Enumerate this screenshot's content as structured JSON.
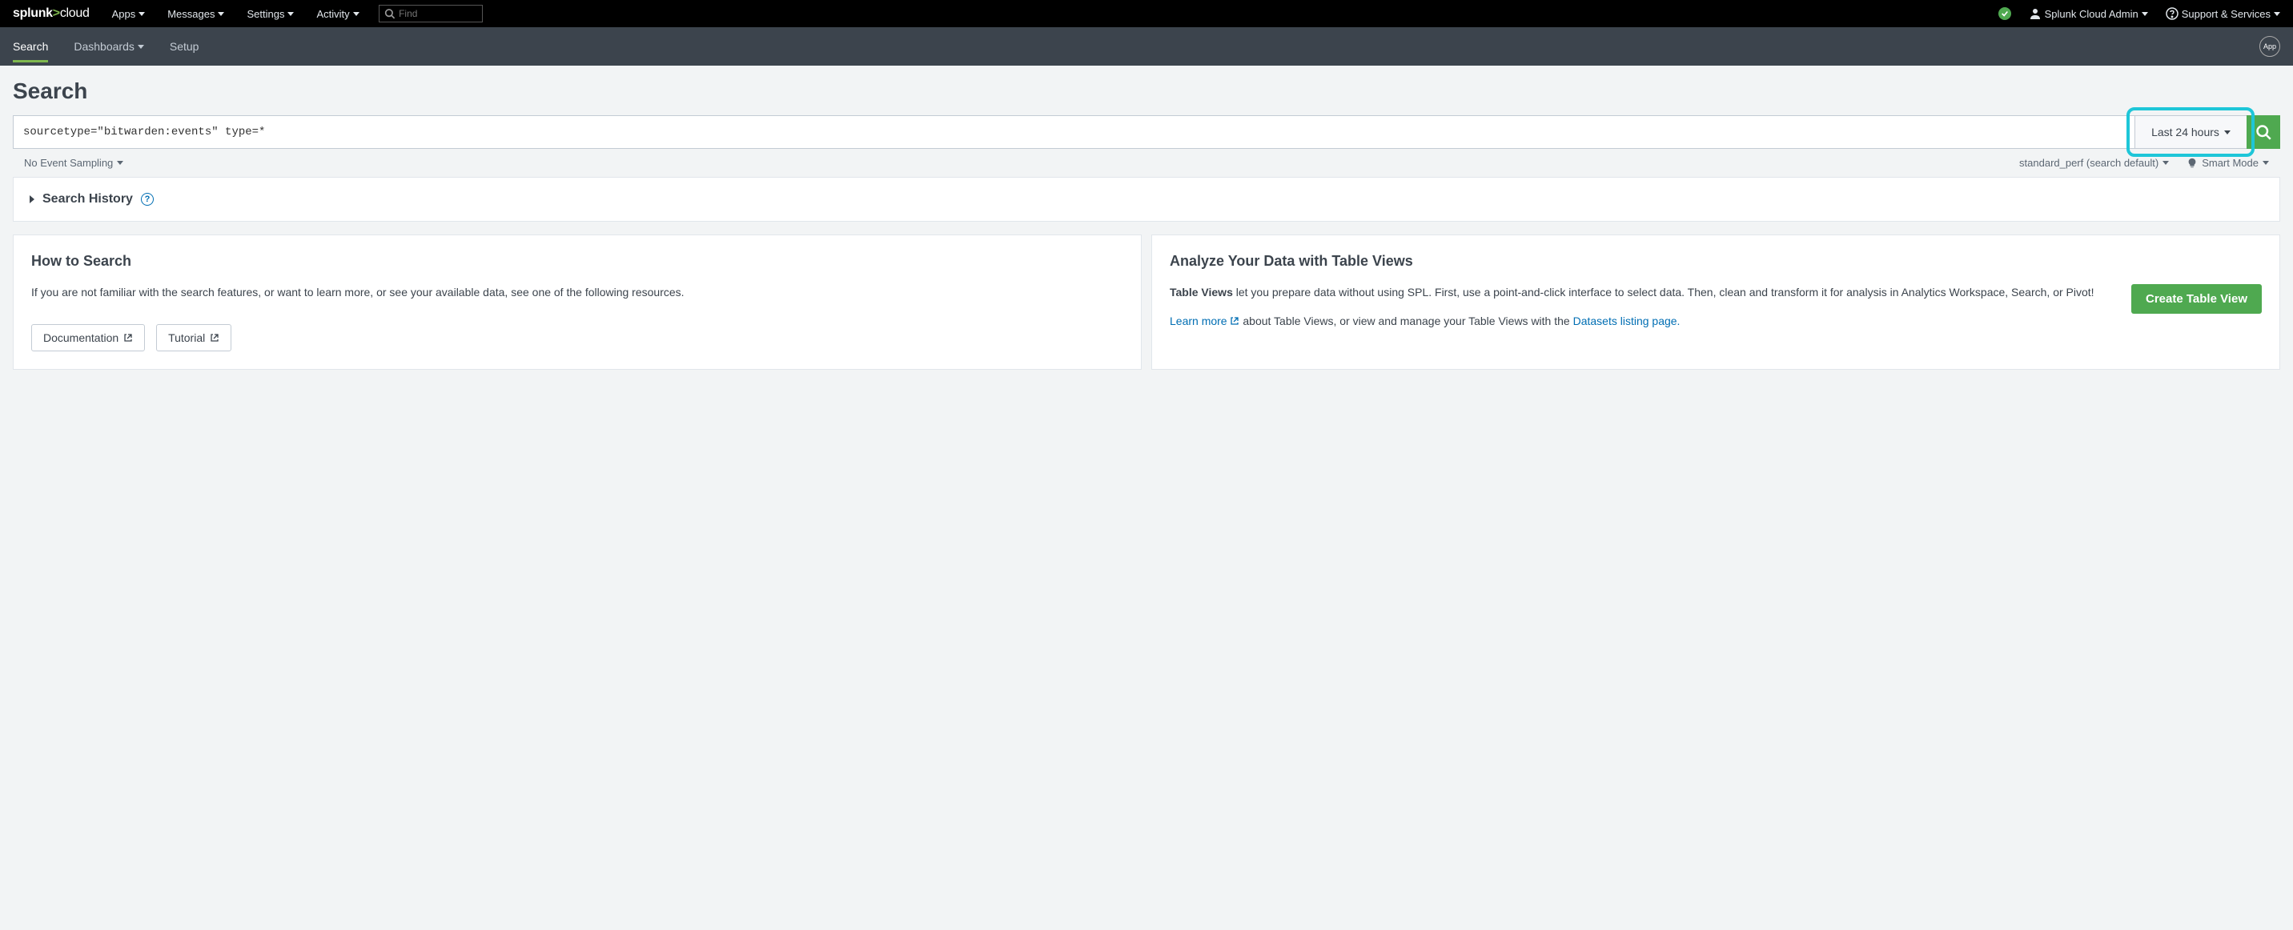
{
  "topbar": {
    "logo_prefix": "splunk",
    "logo_gt": ">",
    "logo_suffix": "cloud",
    "nav": {
      "apps": "Apps",
      "messages": "Messages",
      "settings": "Settings",
      "activity": "Activity"
    },
    "find_placeholder": "Find",
    "user_label": "Splunk Cloud Admin",
    "support_label": "Support & Services"
  },
  "subbar": {
    "search": "Search",
    "dashboards": "Dashboards",
    "setup": "Setup",
    "app_badge": "App"
  },
  "page": {
    "title": "Search"
  },
  "searchbar": {
    "query": "sourcetype=\"bitwarden:events\" type=*",
    "time_range": "Last 24 hours"
  },
  "subrow": {
    "sampling": "No Event Sampling",
    "workload": "standard_perf (search default)",
    "mode": "Smart Mode"
  },
  "history": {
    "title": "Search History"
  },
  "how_to": {
    "title": "How to Search",
    "body": "If you are not familiar with the search features, or want to learn more, or see your available data, see one of the following resources.",
    "doc_btn": "Documentation",
    "tut_btn": "Tutorial"
  },
  "table_views": {
    "title": "Analyze Your Data with Table Views",
    "bold_lead": "Table Views",
    "body_after_bold": " let you prepare data without using SPL. First, use a point-and-click interface to select data. Then, clean and transform it for analysis in Analytics Workspace, Search, or Pivot!",
    "learn_more": "Learn more",
    "body2_mid": " about Table Views, or view and manage your Table Views with the ",
    "datasets_link": "Datasets listing page.",
    "create_btn": "Create Table View"
  }
}
